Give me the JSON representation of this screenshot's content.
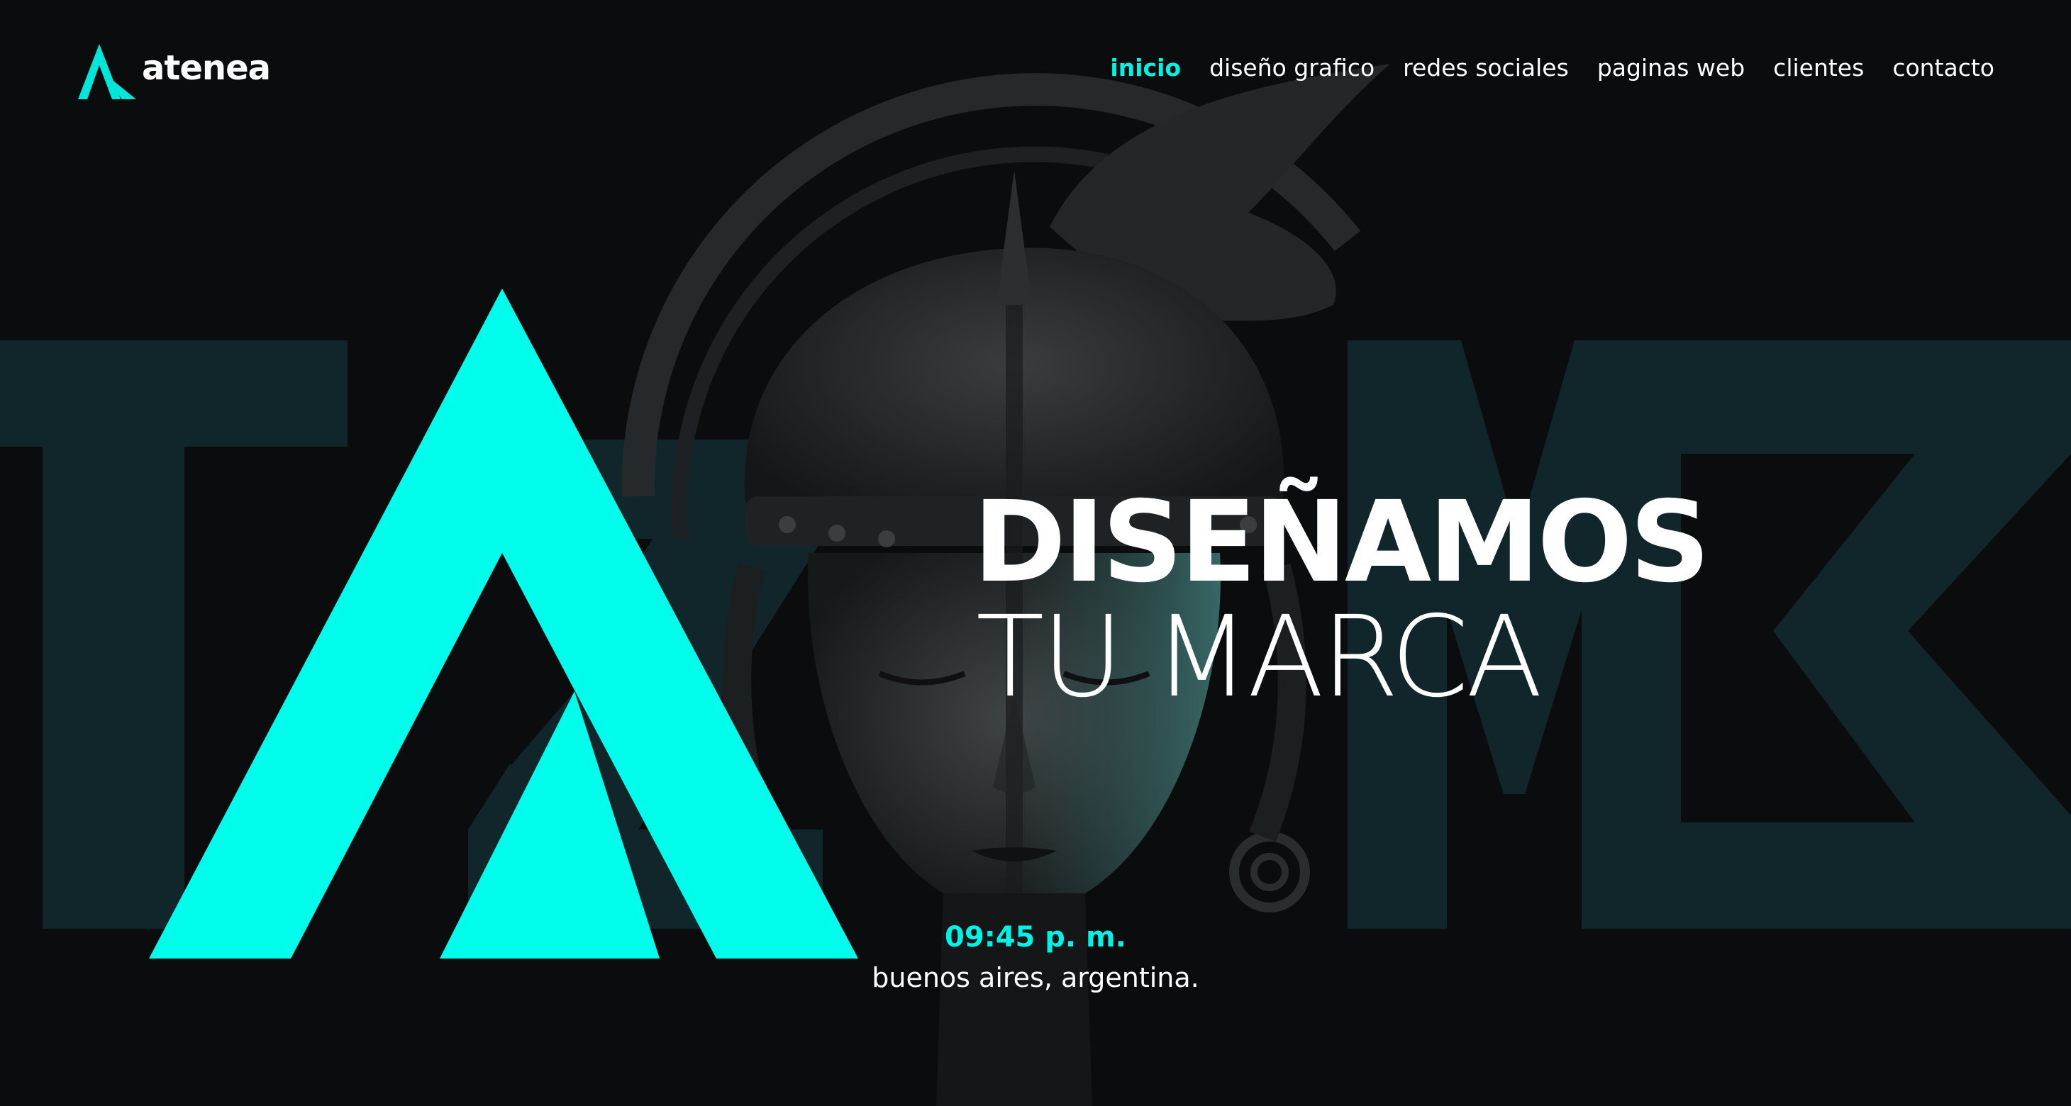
{
  "brand": {
    "name": "atenea",
    "accent": "#00f2e4",
    "background": "#0a0c0e"
  },
  "nav": {
    "items": [
      {
        "label": "inicio",
        "active": true
      },
      {
        "label": "diseño grafico",
        "active": false
      },
      {
        "label": "redes sociales",
        "active": false
      },
      {
        "label": "paginas web",
        "active": false
      },
      {
        "label": "clientes",
        "active": false
      },
      {
        "label": "contacto",
        "active": false
      }
    ]
  },
  "hero": {
    "headline_line1": "DISEÑAMOS",
    "headline_line2": "TU MARCA",
    "time": "09:45 p. m.",
    "location": "buenos aires, argentina.",
    "background_image": "statue-of-athena",
    "logo_icon": "atenea-a-mark-icon"
  }
}
